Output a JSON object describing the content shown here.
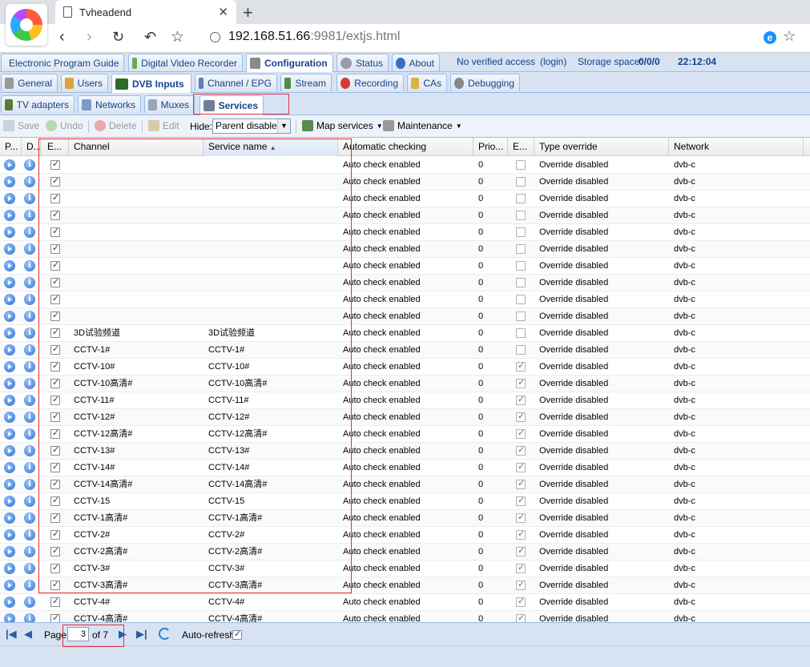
{
  "browser": {
    "tab_title": "Tvheadend",
    "url_host": "192.168.51.66",
    "url_rest": ":9981/extjs.html"
  },
  "top_tabs": [
    "Electronic Program Guide",
    "Digital Video Recorder",
    "Configuration",
    "Status",
    "About"
  ],
  "top_info": {
    "access": "No verified access",
    "login": "(login)",
    "storage_label": "Storage space:",
    "storage_value": "0/0/0",
    "time": "22:12:04"
  },
  "config_tabs": [
    "General",
    "Users",
    "DVB Inputs",
    "Channel / EPG",
    "Stream",
    "Recording",
    "CAs",
    "Debugging"
  ],
  "dvb_tabs": [
    "TV adapters",
    "Networks",
    "Muxes",
    "Services"
  ],
  "toolbar": {
    "save": "Save",
    "undo": "Undo",
    "delete": "Delete",
    "edit": "Edit",
    "hide_label": "Hide:",
    "hide_value": "Parent disabled",
    "map_services": "Map services",
    "maintenance": "Maintenance"
  },
  "columns": {
    "play": "P...",
    "details": "D...",
    "enabled": "E...",
    "channel": "Channel",
    "service_name": "Service name",
    "auto_check": "Automatic checking",
    "priority": "Prio...",
    "encrypted": "E...",
    "type_override": "Type override",
    "network": "Network"
  },
  "rows": [
    {
      "channel": "",
      "service": "",
      "auto": "Auto check enabled",
      "prio": "0",
      "enc": false,
      "override": "Override disabled",
      "network": "dvb-c"
    },
    {
      "channel": "",
      "service": "",
      "auto": "Auto check enabled",
      "prio": "0",
      "enc": false,
      "override": "Override disabled",
      "network": "dvb-c"
    },
    {
      "channel": "",
      "service": "",
      "auto": "Auto check enabled",
      "prio": "0",
      "enc": false,
      "override": "Override disabled",
      "network": "dvb-c"
    },
    {
      "channel": "",
      "service": "",
      "auto": "Auto check enabled",
      "prio": "0",
      "enc": false,
      "override": "Override disabled",
      "network": "dvb-c"
    },
    {
      "channel": "",
      "service": "",
      "auto": "Auto check enabled",
      "prio": "0",
      "enc": false,
      "override": "Override disabled",
      "network": "dvb-c"
    },
    {
      "channel": "",
      "service": "",
      "auto": "Auto check enabled",
      "prio": "0",
      "enc": false,
      "override": "Override disabled",
      "network": "dvb-c"
    },
    {
      "channel": "",
      "service": "",
      "auto": "Auto check enabled",
      "prio": "0",
      "enc": false,
      "override": "Override disabled",
      "network": "dvb-c"
    },
    {
      "channel": "",
      "service": "",
      "auto": "Auto check enabled",
      "prio": "0",
      "enc": false,
      "override": "Override disabled",
      "network": "dvb-c"
    },
    {
      "channel": "",
      "service": "",
      "auto": "Auto check enabled",
      "prio": "0",
      "enc": false,
      "override": "Override disabled",
      "network": "dvb-c"
    },
    {
      "channel": "",
      "service": "",
      "auto": "Auto check enabled",
      "prio": "0",
      "enc": false,
      "override": "Override disabled",
      "network": "dvb-c"
    },
    {
      "channel": "3D试验频道",
      "service": "3D试验频道",
      "auto": "Auto check enabled",
      "prio": "0",
      "enc": false,
      "override": "Override disabled",
      "network": "dvb-c"
    },
    {
      "channel": "CCTV-1#",
      "service": "CCTV-1#",
      "auto": "Auto check enabled",
      "prio": "0",
      "enc": false,
      "override": "Override disabled",
      "network": "dvb-c"
    },
    {
      "channel": "CCTV-10#",
      "service": "CCTV-10#",
      "auto": "Auto check enabled",
      "prio": "0",
      "enc": true,
      "override": "Override disabled",
      "network": "dvb-c"
    },
    {
      "channel": "CCTV-10高清#",
      "service": "CCTV-10高清#",
      "auto": "Auto check enabled",
      "prio": "0",
      "enc": true,
      "override": "Override disabled",
      "network": "dvb-c"
    },
    {
      "channel": "CCTV-11#",
      "service": "CCTV-11#",
      "auto": "Auto check enabled",
      "prio": "0",
      "enc": true,
      "override": "Override disabled",
      "network": "dvb-c"
    },
    {
      "channel": "CCTV-12#",
      "service": "CCTV-12#",
      "auto": "Auto check enabled",
      "prio": "0",
      "enc": true,
      "override": "Override disabled",
      "network": "dvb-c"
    },
    {
      "channel": "CCTV-12高清#",
      "service": "CCTV-12高清#",
      "auto": "Auto check enabled",
      "prio": "0",
      "enc": true,
      "override": "Override disabled",
      "network": "dvb-c"
    },
    {
      "channel": "CCTV-13#",
      "service": "CCTV-13#",
      "auto": "Auto check enabled",
      "prio": "0",
      "enc": true,
      "override": "Override disabled",
      "network": "dvb-c"
    },
    {
      "channel": "CCTV-14#",
      "service": "CCTV-14#",
      "auto": "Auto check enabled",
      "prio": "0",
      "enc": true,
      "override": "Override disabled",
      "network": "dvb-c"
    },
    {
      "channel": "CCTV-14高清#",
      "service": "CCTV-14高清#",
      "auto": "Auto check enabled",
      "prio": "0",
      "enc": true,
      "override": "Override disabled",
      "network": "dvb-c"
    },
    {
      "channel": "CCTV-15",
      "service": "CCTV-15",
      "auto": "Auto check enabled",
      "prio": "0",
      "enc": true,
      "override": "Override disabled",
      "network": "dvb-c"
    },
    {
      "channel": "CCTV-1高清#",
      "service": "CCTV-1高清#",
      "auto": "Auto check enabled",
      "prio": "0",
      "enc": true,
      "override": "Override disabled",
      "network": "dvb-c"
    },
    {
      "channel": "CCTV-2#",
      "service": "CCTV-2#",
      "auto": "Auto check enabled",
      "prio": "0",
      "enc": true,
      "override": "Override disabled",
      "network": "dvb-c"
    },
    {
      "channel": "CCTV-2高清#",
      "service": "CCTV-2高清#",
      "auto": "Auto check enabled",
      "prio": "0",
      "enc": true,
      "override": "Override disabled",
      "network": "dvb-c"
    },
    {
      "channel": "CCTV-3#",
      "service": "CCTV-3#",
      "auto": "Auto check enabled",
      "prio": "0",
      "enc": true,
      "override": "Override disabled",
      "network": "dvb-c"
    },
    {
      "channel": "CCTV-3高清#",
      "service": "CCTV-3高清#",
      "auto": "Auto check enabled",
      "prio": "0",
      "enc": true,
      "override": "Override disabled",
      "network": "dvb-c"
    },
    {
      "channel": "CCTV-4#",
      "service": "CCTV-4#",
      "auto": "Auto check enabled",
      "prio": "0",
      "enc": true,
      "override": "Override disabled",
      "network": "dvb-c"
    },
    {
      "channel": "CCTV-4高清#",
      "service": "CCTV-4高清#",
      "auto": "Auto check enabled",
      "prio": "0",
      "enc": true,
      "override": "Override disabled",
      "network": "dvb-c"
    }
  ],
  "pager": {
    "page_label": "Page",
    "page_value": "3",
    "of_label": "of 7",
    "auto_refresh_label": "Auto-refresh",
    "auto_refresh": true
  }
}
